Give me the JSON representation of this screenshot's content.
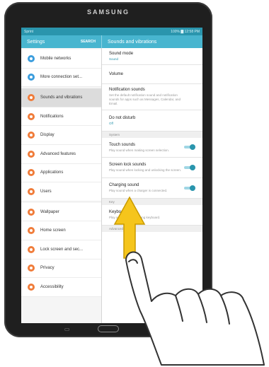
{
  "device": {
    "brand": "SAMSUNG"
  },
  "status_bar": {
    "left": "Sprint",
    "right": "100% ▇ 12:58 PM"
  },
  "topbar": {
    "title": "Settings",
    "search": "SEARCH",
    "page_title": "Sounds and vibrations"
  },
  "sidebar": {
    "groups": [
      {
        "items": [
          {
            "label": "Mobile networks",
            "color": "#3b9ddd",
            "selected": false
          },
          {
            "label": "More connection set...",
            "color": "#3b9ddd",
            "selected": false
          }
        ]
      },
      {
        "items": [
          {
            "label": "Sounds and vibrations",
            "color": "#f07c3a",
            "selected": true
          },
          {
            "label": "Notifications",
            "color": "#f07c3a",
            "selected": false
          },
          {
            "label": "Display",
            "color": "#f07c3a",
            "selected": false
          },
          {
            "label": "Advanced features",
            "color": "#f07c3a",
            "selected": false
          },
          {
            "label": "Applications",
            "color": "#f07c3a",
            "selected": false
          },
          {
            "label": "Users",
            "color": "#f07c3a",
            "selected": false
          }
        ]
      },
      {
        "items": [
          {
            "label": "Wallpaper",
            "color": "#f07c3a",
            "selected": false
          },
          {
            "label": "Home screen",
            "color": "#f07c3a",
            "selected": false
          },
          {
            "label": "Lock screen and sec...",
            "color": "#f07c3a",
            "selected": false
          },
          {
            "label": "Privacy",
            "color": "#f07c3a",
            "selected": false
          },
          {
            "label": "Accessibility",
            "color": "#f07c3a",
            "selected": false
          }
        ]
      }
    ]
  },
  "content": {
    "sound_mode": {
      "title": "Sound mode",
      "value": "Sound"
    },
    "volume": {
      "title": "Volume"
    },
    "notification_sounds": {
      "title": "Notification sounds",
      "desc": "Set the default notification sound and notification sounds for apps such as Messages, Calendar, and Email."
    },
    "do_not_disturb": {
      "title": "Do not disturb",
      "value": "Off"
    },
    "section_system": "System",
    "touch_sounds": {
      "title": "Touch sounds",
      "desc": "Play sound when making screen selection.",
      "on": true
    },
    "screen_lock_sounds": {
      "title": "Screen lock sounds",
      "desc": "Play sound when locking and unlocking the screen.",
      "on": true
    },
    "charging_sound": {
      "title": "Charging sound",
      "desc": "Play sound when a charger is connected.",
      "on": true
    },
    "section_key": "Key",
    "keyboard": {
      "title": "Keyboard",
      "desc": "Play a sound ... Samsung keyboard."
    },
    "section_advanced": "Advanced"
  },
  "colors": {
    "accent": "#48b5cf",
    "status": "#2a95ad",
    "arrow": "#f5c51c"
  }
}
